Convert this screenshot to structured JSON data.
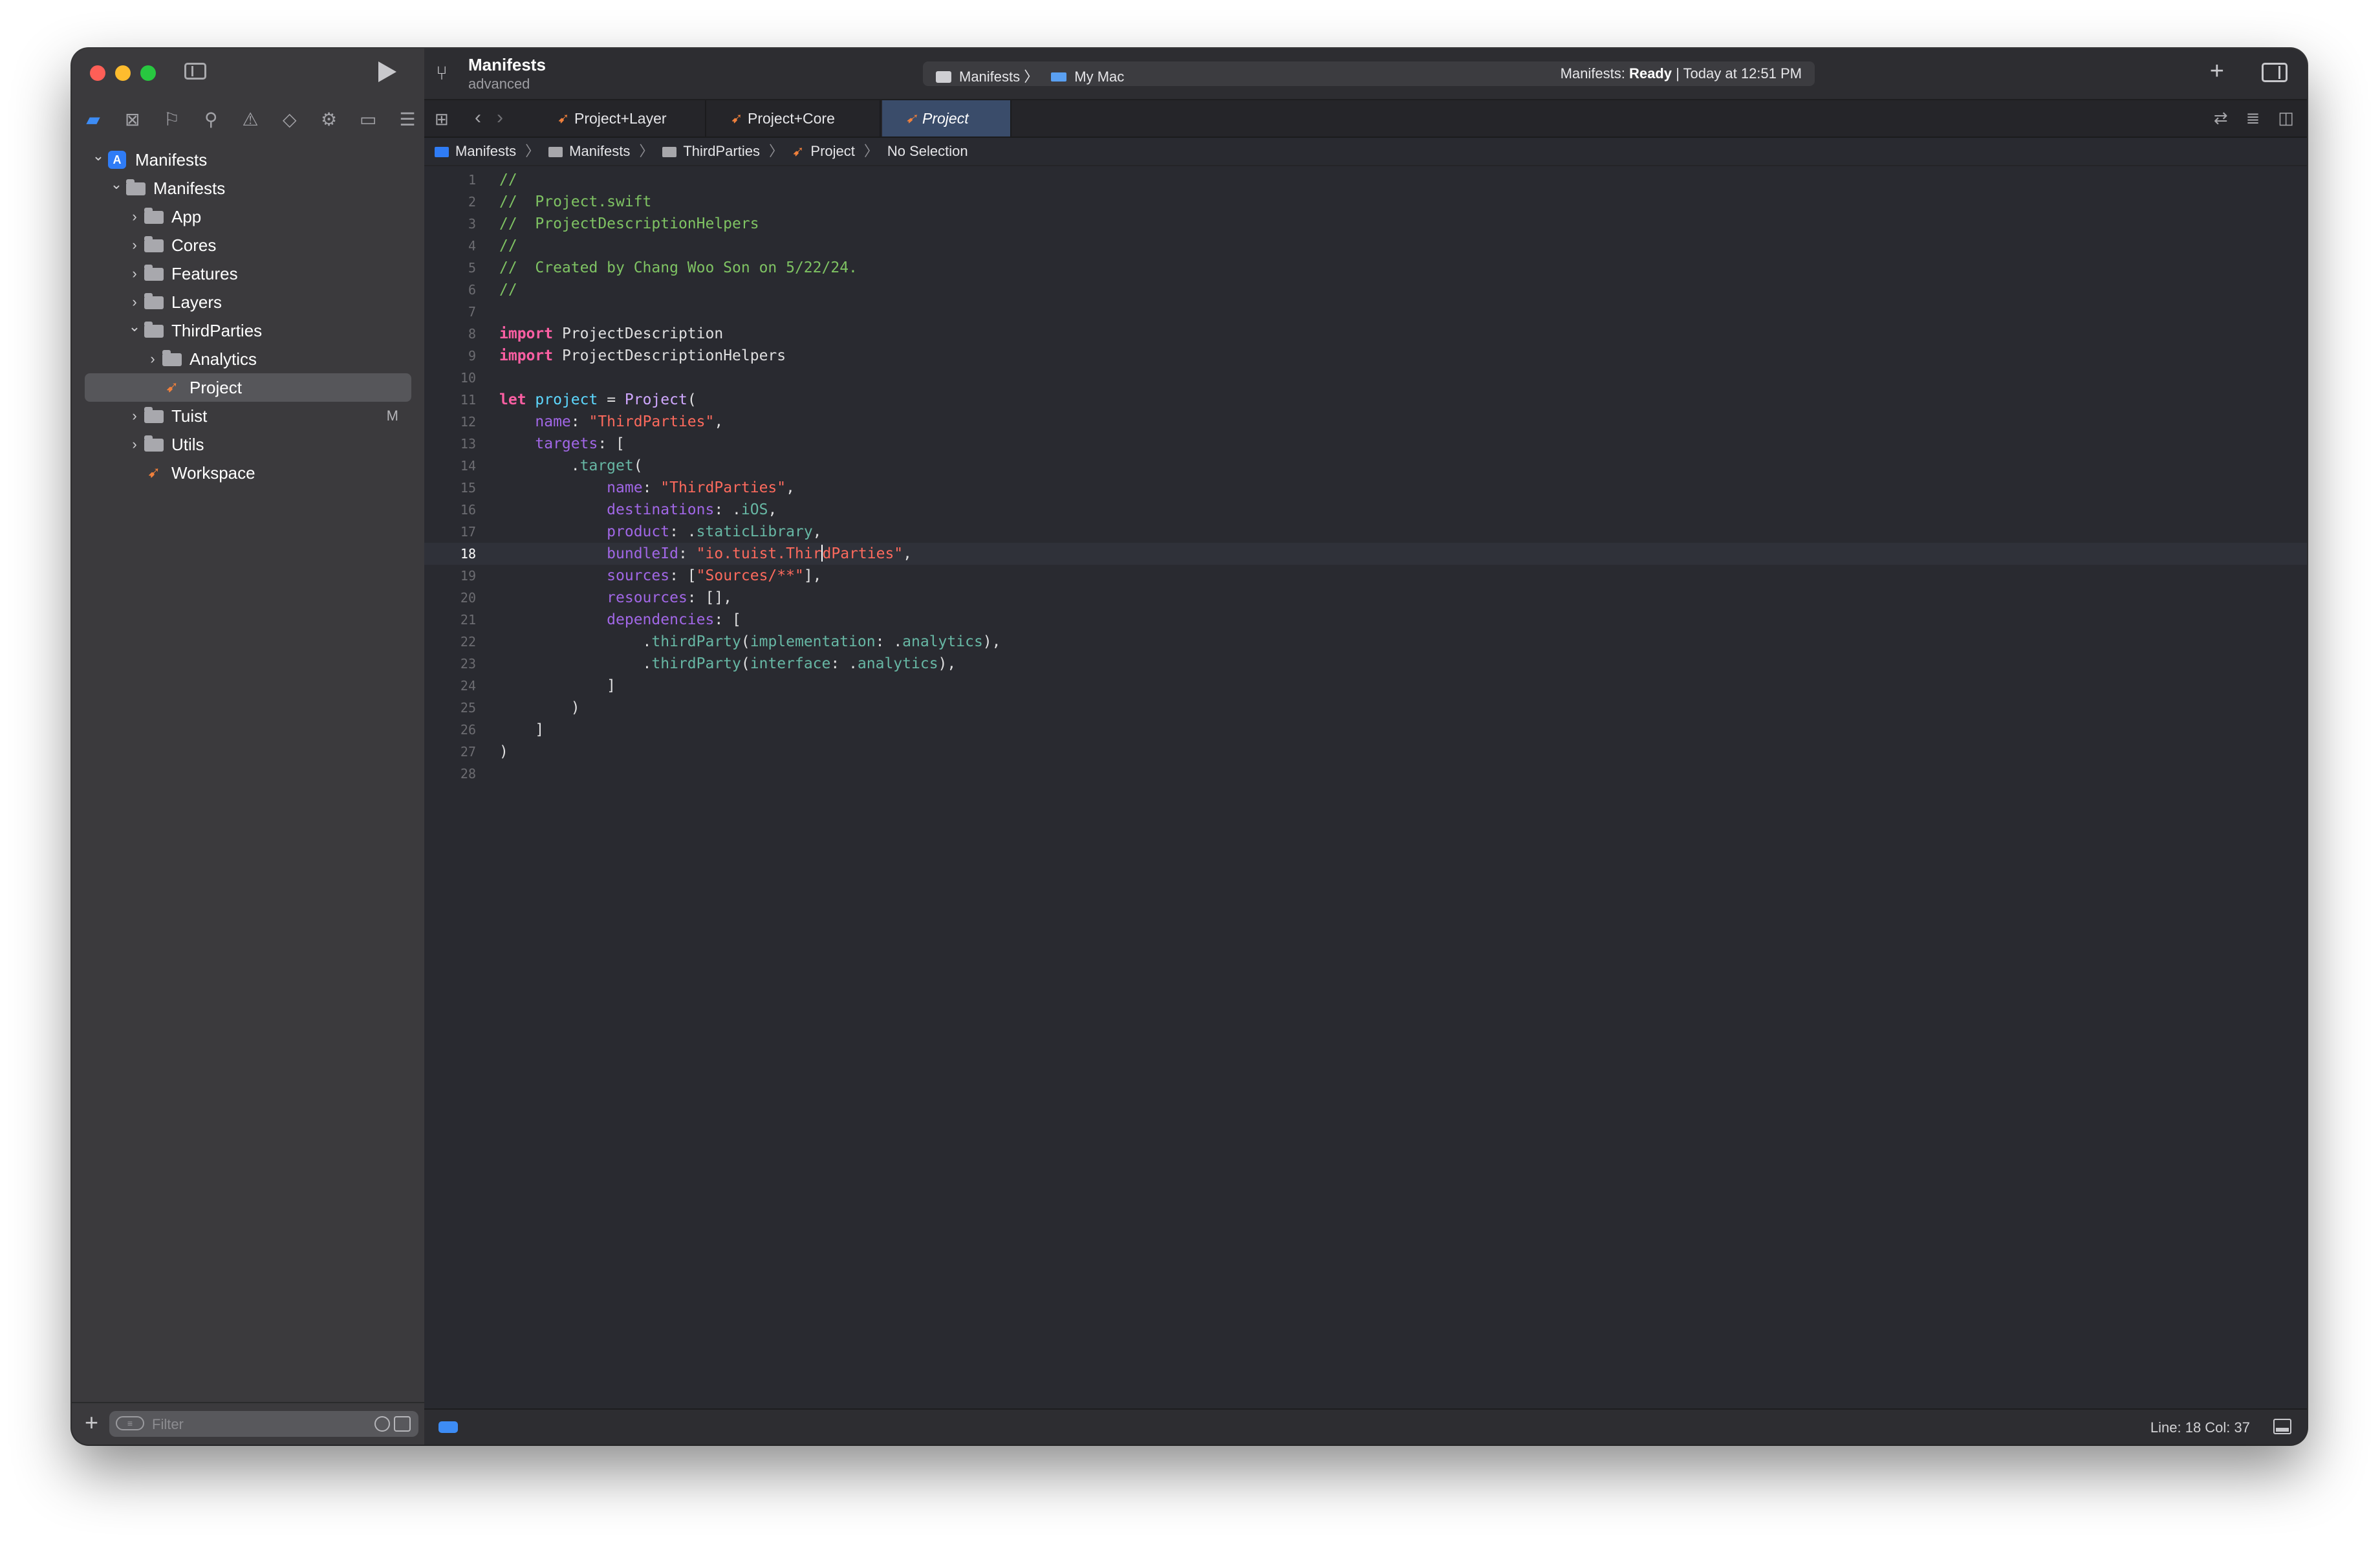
{
  "toolbar": {
    "project_title": "Manifests",
    "project_subtitle": "advanced",
    "scheme": "Manifests",
    "destination": "My Mac",
    "status_prefix": "Manifests:",
    "status_state": "Ready",
    "status_suffix": "| Today at 12:51 PM"
  },
  "tabs": [
    {
      "label": "Project+Layer",
      "active": false
    },
    {
      "label": "Project+Core",
      "active": false
    },
    {
      "label": "Project",
      "active": true
    }
  ],
  "breadcrumb": {
    "items": [
      "Manifests",
      "Manifests",
      "ThirdParties",
      "Project"
    ],
    "last": "No Selection"
  },
  "navigator": {
    "tree": [
      {
        "label": "Manifests",
        "depth": 0,
        "kind": "app",
        "expanded": true
      },
      {
        "label": "Manifests",
        "depth": 1,
        "kind": "folder",
        "expanded": true
      },
      {
        "label": "App",
        "depth": 2,
        "kind": "folder",
        "expanded": false
      },
      {
        "label": "Cores",
        "depth": 2,
        "kind": "folder",
        "expanded": false
      },
      {
        "label": "Features",
        "depth": 2,
        "kind": "folder",
        "expanded": false
      },
      {
        "label": "Layers",
        "depth": 2,
        "kind": "folder",
        "expanded": false
      },
      {
        "label": "ThirdParties",
        "depth": 2,
        "kind": "folder",
        "expanded": true
      },
      {
        "label": "Analytics",
        "depth": 3,
        "kind": "folder",
        "expanded": false
      },
      {
        "label": "Project",
        "depth": 3,
        "kind": "swift",
        "selected": true
      },
      {
        "label": "Tuist",
        "depth": 2,
        "kind": "folder",
        "expanded": false,
        "badge": "M"
      },
      {
        "label": "Utils",
        "depth": 2,
        "kind": "folder",
        "expanded": false
      },
      {
        "label": "Workspace",
        "depth": 2,
        "kind": "swift"
      }
    ],
    "filter_placeholder": "Filter"
  },
  "code": {
    "current_line": 18,
    "lines": [
      [
        [
          "c-cmt",
          "//"
        ]
      ],
      [
        [
          "c-cmt",
          "//  Project.swift"
        ]
      ],
      [
        [
          "c-cmt",
          "//  ProjectDescriptionHelpers"
        ]
      ],
      [
        [
          "c-cmt",
          "//"
        ]
      ],
      [
        [
          "c-cmt",
          "//  Created by Chang Woo Son on 5/22/24."
        ]
      ],
      [
        [
          "c-cmt",
          "//"
        ]
      ],
      [],
      [
        [
          "c-kw",
          "import"
        ],
        [
          "",
          " ProjectDescription"
        ]
      ],
      [
        [
          "c-kw",
          "import"
        ],
        [
          "",
          " ProjectDescriptionHelpers"
        ]
      ],
      [],
      [
        [
          "c-kw",
          "let"
        ],
        [
          "",
          " "
        ],
        [
          "c-var",
          "project"
        ],
        [
          "",
          " = "
        ],
        [
          "c-cls",
          "Project"
        ],
        [
          "",
          "("
        ]
      ],
      [
        [
          "",
          "    "
        ],
        [
          "c-prop",
          "name"
        ],
        [
          "",
          ": "
        ],
        [
          "c-str",
          "\"ThirdParties\""
        ],
        [
          "",
          ","
        ]
      ],
      [
        [
          "",
          "    "
        ],
        [
          "c-prop",
          "targets"
        ],
        [
          "",
          ": ["
        ]
      ],
      [
        [
          "",
          "        ."
        ],
        [
          "c-fn",
          "target"
        ],
        [
          "",
          "("
        ]
      ],
      [
        [
          "",
          "            "
        ],
        [
          "c-prop",
          "name"
        ],
        [
          "",
          ": "
        ],
        [
          "c-str",
          "\"ThirdParties\""
        ],
        [
          "",
          ","
        ]
      ],
      [
        [
          "",
          "            "
        ],
        [
          "c-prop",
          "destinations"
        ],
        [
          "",
          ": ."
        ],
        [
          "c-fn",
          "iOS"
        ],
        [
          "",
          ","
        ]
      ],
      [
        [
          "",
          "            "
        ],
        [
          "c-prop",
          "product"
        ],
        [
          "",
          ": ."
        ],
        [
          "c-fn",
          "staticLibrary"
        ],
        [
          "",
          ","
        ]
      ],
      [
        [
          "",
          "            "
        ],
        [
          "c-prop",
          "bundleId"
        ],
        [
          "",
          ": "
        ],
        [
          "c-str",
          "\"io.tuist.Thir"
        ],
        [
          "cursor",
          ""
        ],
        [
          "c-str",
          "dParties\""
        ],
        [
          "",
          ","
        ]
      ],
      [
        [
          "",
          "            "
        ],
        [
          "c-prop",
          "sources"
        ],
        [
          "",
          ": ["
        ],
        [
          "c-str",
          "\"Sources/**\""
        ],
        [
          "",
          "],"
        ]
      ],
      [
        [
          "",
          "            "
        ],
        [
          "c-prop",
          "resources"
        ],
        [
          "",
          ": [],"
        ]
      ],
      [
        [
          "",
          "            "
        ],
        [
          "c-prop",
          "dependencies"
        ],
        [
          "",
          ": ["
        ]
      ],
      [
        [
          "",
          "                ."
        ],
        [
          "c-fn",
          "thirdParty"
        ],
        [
          "",
          "("
        ],
        [
          "c-fn",
          "implementation"
        ],
        [
          "",
          ": ."
        ],
        [
          "c-fn",
          "analytics"
        ],
        [
          "",
          "),"
        ]
      ],
      [
        [
          "",
          "                ."
        ],
        [
          "c-fn",
          "thirdParty"
        ],
        [
          "",
          "("
        ],
        [
          "c-fn",
          "interface"
        ],
        [
          "",
          ": ."
        ],
        [
          "c-fn",
          "analytics"
        ],
        [
          "",
          "),"
        ]
      ],
      [
        [
          "",
          "            ]"
        ]
      ],
      [
        [
          "",
          "        )"
        ]
      ],
      [
        [
          "",
          "    ]"
        ]
      ],
      [
        [
          "",
          ")"
        ]
      ],
      []
    ]
  },
  "statusbar": {
    "position": "Line: 18  Col: 37"
  },
  "colors": {
    "accent": "#3d8cf5",
    "swift": "#f0803c",
    "comment": "#7fc363",
    "keyword": "#fc5fa3",
    "string": "#fc6a5d"
  }
}
